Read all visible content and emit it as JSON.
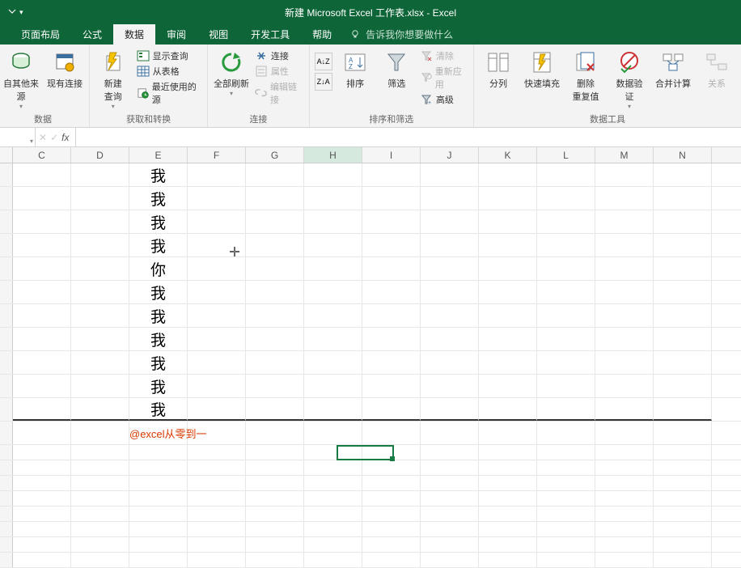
{
  "title": "新建 Microsoft Excel 工作表.xlsx  -  Excel",
  "tabs": {
    "items": [
      "页面布局",
      "公式",
      "数据",
      "审阅",
      "视图",
      "开发工具",
      "帮助"
    ],
    "active_index": 2,
    "tell_me": "告诉我你想要做什么"
  },
  "ribbon": {
    "group0": {
      "label": "数据",
      "btns": {
        "other_sources": "自其他来源",
        "existing_conn": "现有连接"
      }
    },
    "group1": {
      "label": "获取和转换",
      "new_query": "新建\n查询",
      "show_query": "显示查询",
      "from_table": "从表格",
      "recent_sources": "最近使用的源"
    },
    "group2": {
      "label": "连接",
      "refresh_all": "全部刷新",
      "connections": "连接",
      "properties": "属性",
      "edit_links": "编辑链接"
    },
    "group3": {
      "label": "排序和筛选",
      "sort": "排序",
      "filter": "筛选",
      "clear": "清除",
      "reapply": "重新应用",
      "advanced": "高级"
    },
    "group4": {
      "label": "数据工具",
      "text_to_cols": "分列",
      "flash_fill": "快速填充",
      "remove_dup": "删除\n重复值",
      "data_valid": "数据验\n证",
      "consolidate": "合并计算",
      "relations": "关系"
    }
  },
  "formula_bar": {
    "name_box": "",
    "fx": "fx",
    "value": ""
  },
  "columns": [
    "C",
    "D",
    "E",
    "F",
    "G",
    "H",
    "I",
    "J",
    "K",
    "L",
    "M",
    "N"
  ],
  "selected_col": "H",
  "chart_data": {
    "type": "table",
    "columns": [
      "E"
    ],
    "rows": [
      [
        "我"
      ],
      [
        "我"
      ],
      [
        "我"
      ],
      [
        "我"
      ],
      [
        "你"
      ],
      [
        "我"
      ],
      [
        "我"
      ],
      [
        "我"
      ],
      [
        "我"
      ],
      [
        "我"
      ],
      [
        "我"
      ]
    ]
  },
  "e_values": [
    "我",
    "我",
    "我",
    "我",
    "你",
    "我",
    "我",
    "我",
    "我",
    "我",
    "我"
  ],
  "annotation": "@excel从零到一"
}
